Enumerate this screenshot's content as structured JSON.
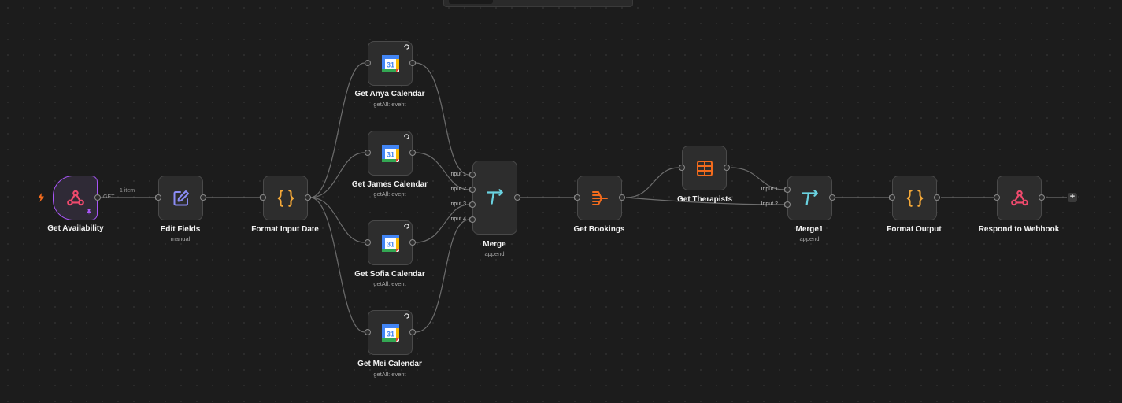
{
  "canvas": {
    "background": "#1c1c1c",
    "accent_trigger": "#a855f7",
    "webhook_color": "#ef4a6d",
    "code_color": "#f4a838",
    "merge_color": "#6ad2e0",
    "orange_color": "#f26b1d",
    "edit_color": "#8b8cf5"
  },
  "nodes": {
    "get_availability": {
      "label": "Get Availability",
      "icon": "webhook-icon"
    },
    "edit_fields": {
      "label": "Edit Fields",
      "subtitle": "manual",
      "icon": "pencil-icon"
    },
    "format_input_date": {
      "label": "Format Input Date",
      "icon": "code-braces-icon"
    },
    "get_anya_calendar": {
      "label": "Get Anya Calendar",
      "subtitle": "getAll: event",
      "icon": "google-calendar-icon"
    },
    "get_james_calendar": {
      "label": "Get James Calendar",
      "subtitle": "getAll: event",
      "icon": "google-calendar-icon"
    },
    "get_sofia_calendar": {
      "label": "Get Sofia Calendar",
      "subtitle": "getAll: event",
      "icon": "google-calendar-icon"
    },
    "get_mei_calendar": {
      "label": "Get Mei Calendar",
      "subtitle": "getAll: event",
      "icon": "google-calendar-icon"
    },
    "merge": {
      "label": "Merge",
      "subtitle": "append",
      "icon": "merge-icon",
      "inputs": [
        "Input 1",
        "Input 2",
        "Input 3",
        "Input 4"
      ]
    },
    "get_bookings": {
      "label": "Get Bookings",
      "icon": "filter-funnel-icon"
    },
    "get_therapists": {
      "label": "Get Therapists",
      "icon": "table-icon"
    },
    "merge1": {
      "label": "Merge1",
      "subtitle": "append",
      "icon": "merge-icon",
      "inputs": [
        "Input 1",
        "Input 2"
      ]
    },
    "format_output": {
      "label": "Format Output",
      "icon": "code-braces-icon"
    },
    "respond_to_webhook": {
      "label": "Respond to Webhook",
      "icon": "webhook-icon"
    }
  },
  "edges": {
    "trigger_edge": {
      "method": "GET",
      "items": "1 item"
    }
  },
  "controls": {
    "add_node": "+"
  }
}
